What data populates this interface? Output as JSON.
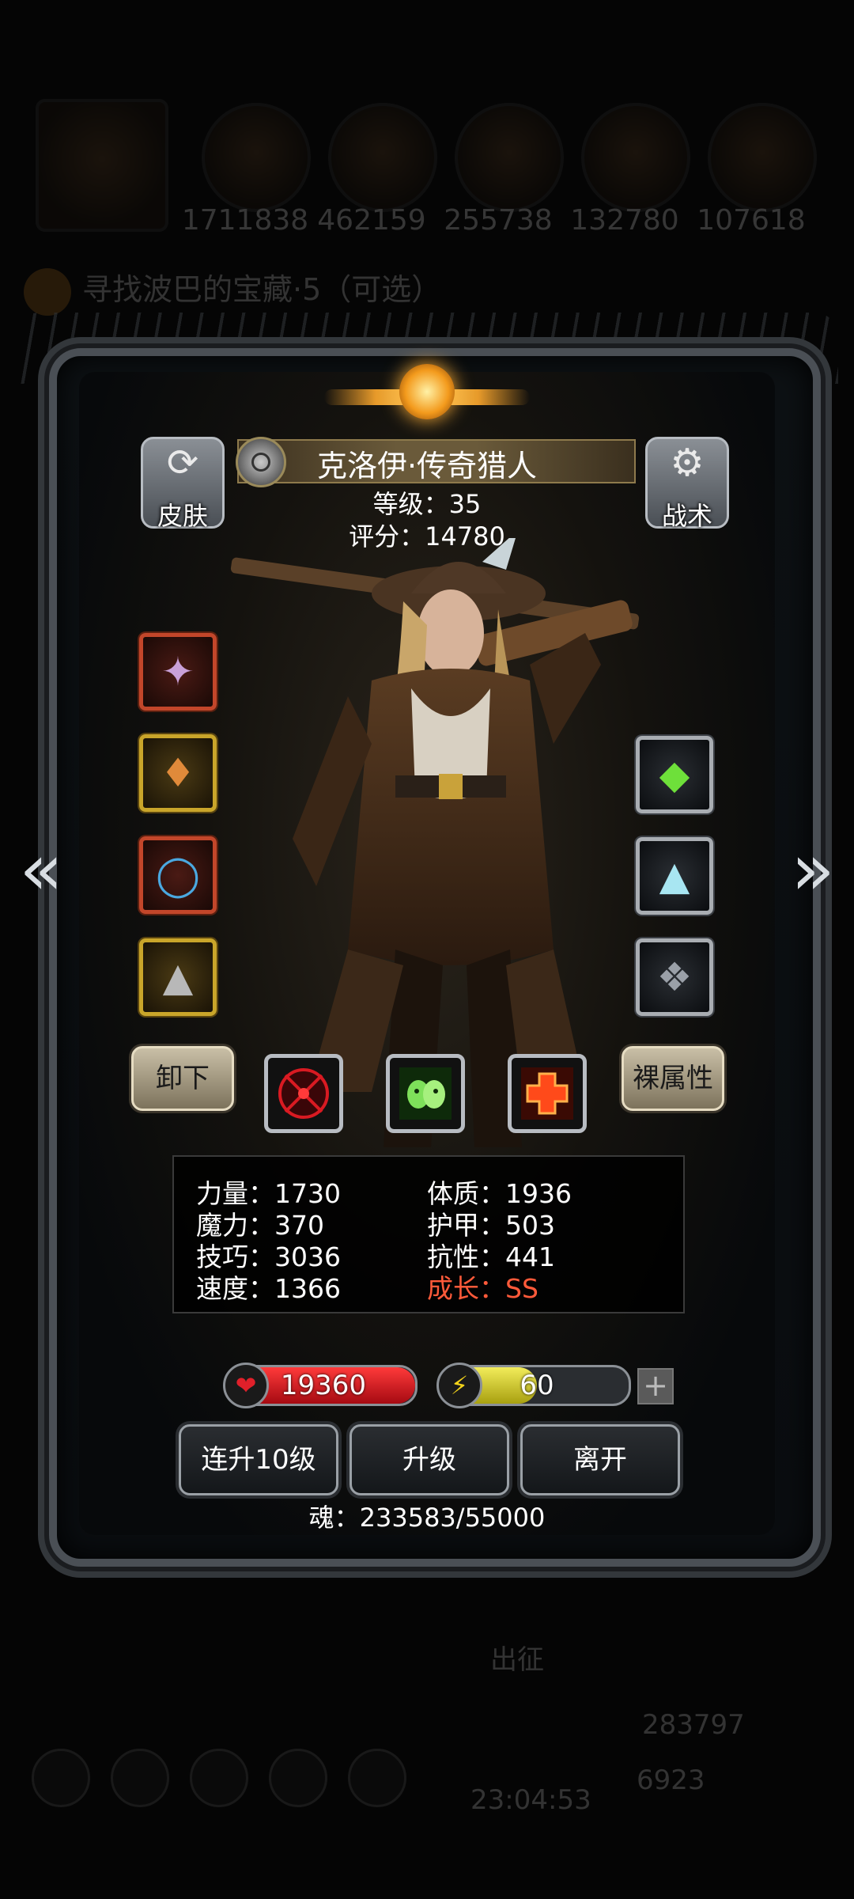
{
  "background": {
    "resources": [
      "1711838",
      "462159",
      "255738",
      "132780",
      "107618"
    ],
    "quest": "寻找波巴的宝藏·5（可选）",
    "bottom_labels": [
      "出征"
    ],
    "timer": "23:04:53",
    "currency_gold": "283797",
    "currency_gem": "6923"
  },
  "hero": {
    "name": "克洛伊·传奇猎人",
    "level": "等级：35",
    "score": "评分：14780"
  },
  "buttons": {
    "skin": "皮肤",
    "tactics": "战术",
    "unequip": "卸下",
    "base_attributes": "裸属性",
    "level_up_10": "连升10级",
    "level_up": "升级",
    "leave": "离开"
  },
  "stats": {
    "strength": "力量：1730",
    "constitution": "体质：1936",
    "magic": "魔力：370",
    "armor": "护甲：503",
    "skill": "技巧：3036",
    "resistance": "抗性：441",
    "speed": "速度：1366",
    "growth": "成长：SS"
  },
  "bars": {
    "hp_value": "19360",
    "energy_value": "60",
    "energy_fraction": 0.5
  },
  "soul": "魂：233583/55000",
  "colors": {
    "growth": "#ff5a3a",
    "hp": "#d6111a",
    "energy": "#d9d21a"
  },
  "icons": {
    "skin_button": "shirt-refresh-icon",
    "tactics_button": "gear-icon",
    "nav_left": "double-chevron-left-icon",
    "nav_right": "double-chevron-right-icon",
    "hp": "heart-icon",
    "energy": "lightning-icon"
  }
}
